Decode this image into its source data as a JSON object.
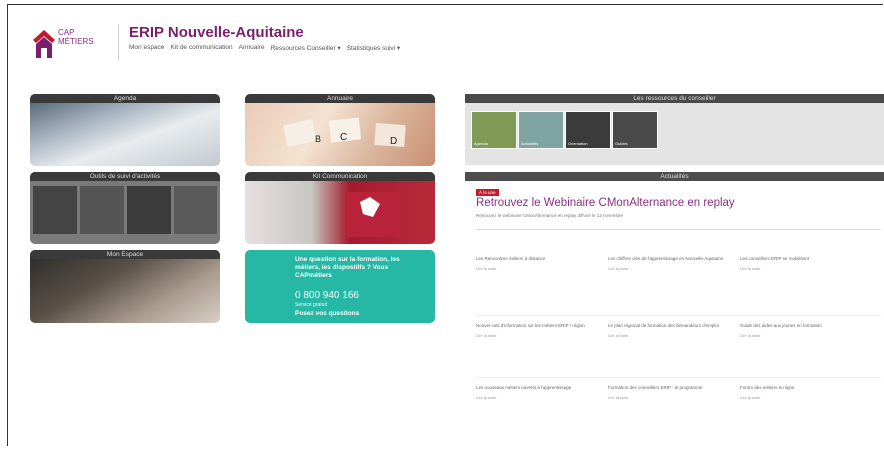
{
  "header": {
    "logo_lines": [
      "CAP",
      "MÉTIERS"
    ],
    "title": "ERIP Nouvelle-Aquitaine",
    "nav": [
      "Mon espace",
      "Kit de communication",
      "Annuaire",
      "Ressources Conseiller ▾",
      "Statistiques suivi ▾"
    ]
  },
  "tiles": {
    "agenda": "Agenda",
    "annuaire": "Annuaire",
    "outils": "Outils de suivi d'activités",
    "kit": "Kit Communication",
    "mon_espace": "Mon Espace",
    "question": {
      "text": "Une question sur la formation, les métiers, les dispositifs ? Vous CAPmétiers",
      "tel": "0 800 940 166",
      "sub": "Service gratuit",
      "link": "Posez vos questions"
    }
  },
  "ressources": {
    "title": "Les ressources du conseiller",
    "thumbs": [
      "Agenda",
      "Actualités",
      "Orientation",
      "Guides"
    ]
  },
  "actualites": {
    "title": "Actualités",
    "badge": "À la une",
    "headline": "Retrouvez le Webinaire CMonAlternance en replay",
    "sub": "Retrouvez le webinaire CMonAlternance en replay diffusé le 12 novembre",
    "cards": [
      {
        "title": "Les Rencontres métiers à distance",
        "meta": "Lire la suite"
      },
      {
        "title": "Les chiffres clés de l'apprentissage en Nouvelle-Aquitaine",
        "meta": "Lire la suite"
      },
      {
        "title": "Les conseillers ERIP se mobilisent",
        "meta": "Lire la suite"
      },
      {
        "title": "Nouvel outil d'information sur les métiers ERIP / région",
        "meta": "Lire la suite"
      },
      {
        "title": "Le plan régional de formation des demandeurs d'emploi",
        "meta": "Lire la suite"
      },
      {
        "title": "Guide des aides aux jeunes en formation",
        "meta": "Lire la suite"
      },
      {
        "title": "Les nouveaux métiers ouverts à l'apprentissage",
        "meta": "Lire la suite"
      },
      {
        "title": "Formation des conseillers ERIP : le programme",
        "meta": "Lire la suite"
      },
      {
        "title": "Forum des métiers en ligne",
        "meta": "Lire la suite"
      }
    ]
  },
  "colors": {
    "brand": "#7a1f6e",
    "teal": "#26b7a5",
    "accent_red": "#c21c2c"
  }
}
